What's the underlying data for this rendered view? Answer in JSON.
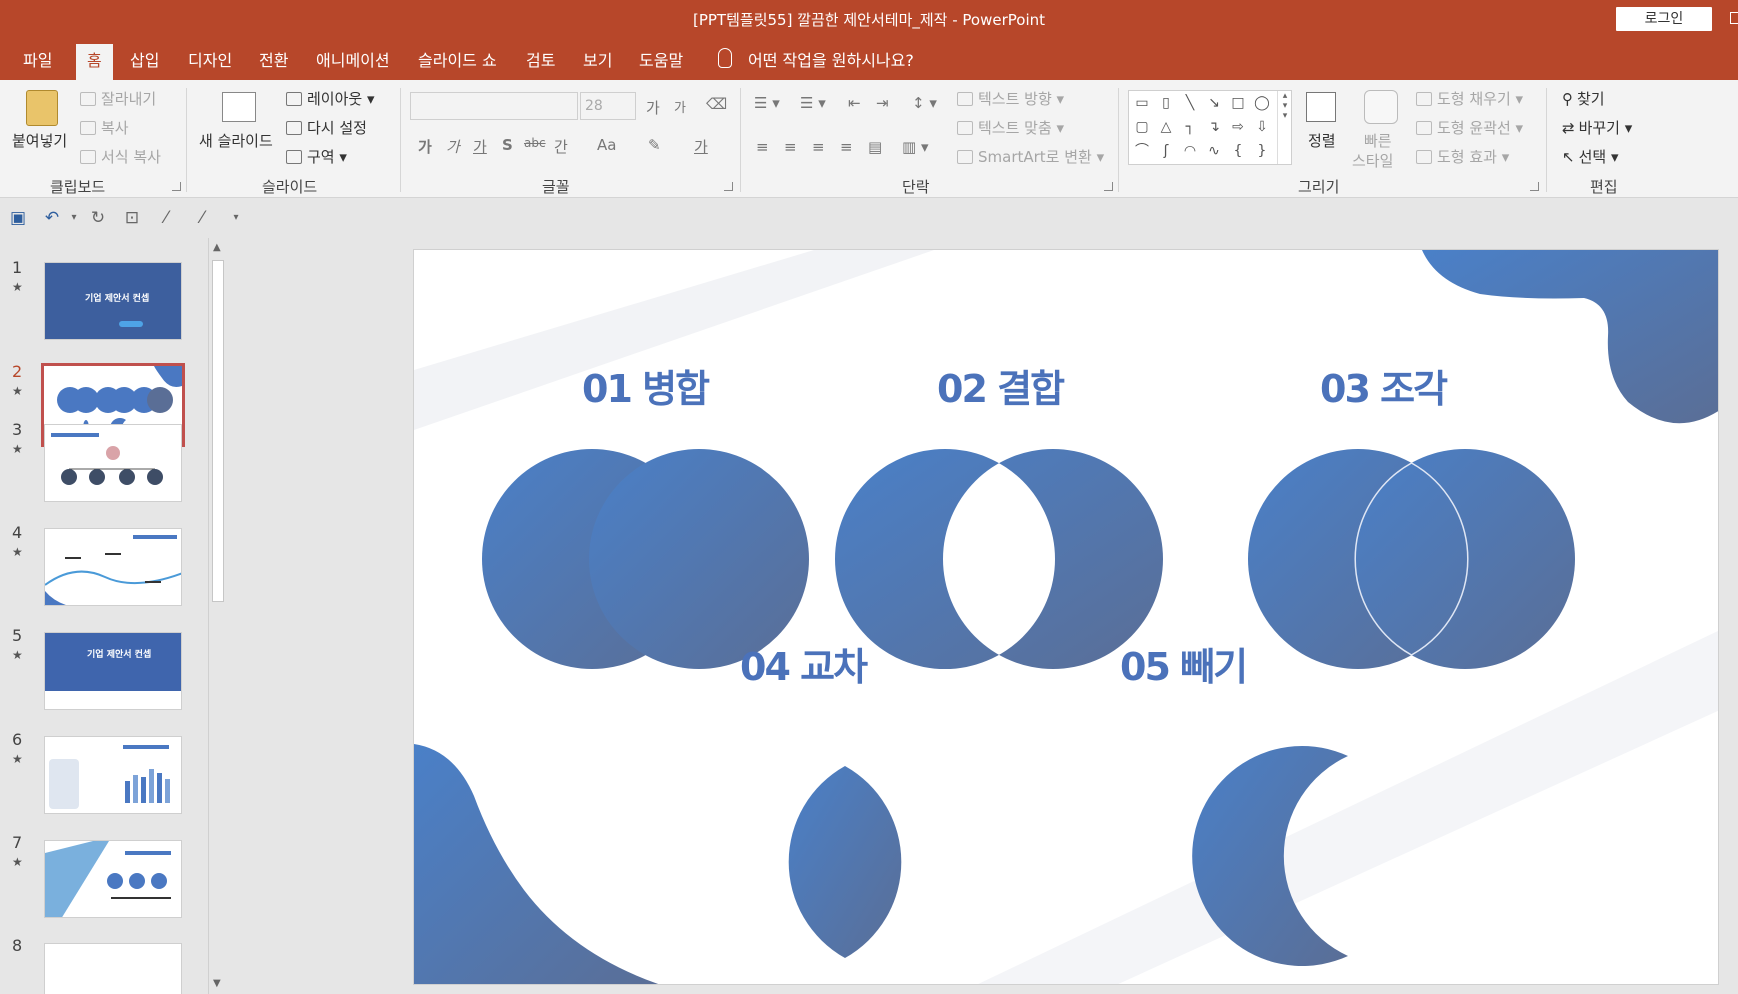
{
  "window": {
    "title": "[PPT템플릿55] 깔끔한 제안서테마_제작  -  PowerPoint",
    "login": "로그인"
  },
  "tabs": [
    "파일",
    "홈",
    "삽입",
    "디자인",
    "전환",
    "애니메이션",
    "슬라이드 쇼",
    "검토",
    "보기",
    "도움말"
  ],
  "tell_me": "어떤 작업을 원하시나요?",
  "ribbon": {
    "clipboard": {
      "label": "클립보드",
      "paste": "붙여넣기",
      "cut": "잘라내기",
      "copy": "복사",
      "format_painter": "서식 복사"
    },
    "slides": {
      "label": "슬라이드",
      "new_slide": "새 슬라이드",
      "layout": "레이아웃",
      "reset": "다시 설정",
      "section": "구역"
    },
    "font": {
      "label": "글꼴",
      "size": "28",
      "grow": "가",
      "shrink": "가",
      "bold": "가",
      "italic": "가",
      "underline": "가",
      "shadow": "S",
      "strike": "abc",
      "spacing": "간",
      "case": "Aa",
      "color": "가"
    },
    "paragraph": {
      "label": "단락",
      "text_direction": "텍스트 방향",
      "align_text": "텍스트 맞춤",
      "smartart": "SmartArt로 변환"
    },
    "drawing": {
      "label": "그리기",
      "arrange": "정렬",
      "quick_styles": "빠른\n스타일",
      "quick_styles_1": "빠른",
      "quick_styles_2": "스타일",
      "fill": "도형 채우기",
      "outline": "도형 윤곽선",
      "effects": "도형 효과"
    },
    "editing": {
      "label": "편집",
      "find": "찾기",
      "replace": "바꾸기",
      "select": "선택"
    }
  },
  "thumbnails": [
    {
      "num": "1",
      "text": "기업 제안서 컨셉"
    },
    {
      "num": "2",
      "text": ""
    },
    {
      "num": "3",
      "text": ""
    },
    {
      "num": "4",
      "text": ""
    },
    {
      "num": "5",
      "text": "기업 제안서 컨셉"
    },
    {
      "num": "6",
      "text": ""
    },
    {
      "num": "7",
      "text": ""
    },
    {
      "num": "8",
      "text": ""
    }
  ],
  "slide": {
    "titles": [
      "01 병합",
      "02 결합",
      "03 조각",
      "04 교차",
      "05 빼기"
    ]
  },
  "colors": {
    "accent": "#b7472a",
    "shape_light": "#4a80c8",
    "shape_dark": "#5a6e96"
  }
}
